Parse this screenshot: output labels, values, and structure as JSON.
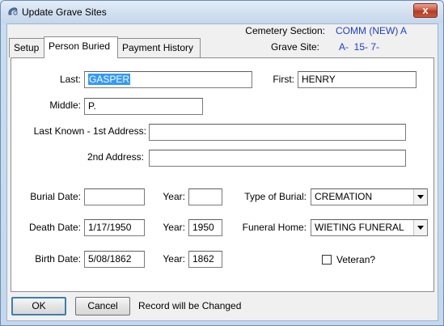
{
  "window": {
    "title": "Update Grave Sites",
    "close_glyph": "x"
  },
  "header": {
    "cemetery_section_label": "Cemetery Section:",
    "cemetery_section_value": "COMM (NEW) A",
    "grave_site_label": "Grave Site:",
    "grave_site_value": "A-  15- 7-"
  },
  "tabs": [
    {
      "label": "Setup"
    },
    {
      "label": "Person Buried",
      "active": true
    },
    {
      "label": "Payment History"
    }
  ],
  "form": {
    "last_label": "Last:",
    "last_value": "GASPER",
    "first_label": "First:",
    "first_value": "HENRY",
    "middle_label": "Middle:",
    "middle_value": "P.",
    "address1_label": "Last Known - 1st Address:",
    "address1_value": "",
    "address2_label": "2nd Address:",
    "address2_value": "",
    "burial_date_label": "Burial Date:",
    "burial_date_value": "",
    "burial_year_label": "Year:",
    "burial_year_value": "",
    "type_of_burial_label": "Type of Burial:",
    "type_of_burial_value": "CREMATION",
    "death_date_label": "Death Date:",
    "death_date_value": "1/17/1950",
    "death_year_label": "Year:",
    "death_year_value": "1950",
    "funeral_home_label": "Funeral Home:",
    "funeral_home_value": "WIETING FUNERAL",
    "birth_date_label": "Birth Date:",
    "birth_date_value": "5/08/1862",
    "birth_year_label": "Year:",
    "birth_year_value": "1862",
    "veteran_label": "Veteran?",
    "veteran_checked": false
  },
  "footer": {
    "ok_label": "OK",
    "cancel_label": "Cancel",
    "status_text": "Record will be Changed"
  },
  "colors": {
    "header_value": "#1a3fcf",
    "selection": "#3399ff"
  }
}
